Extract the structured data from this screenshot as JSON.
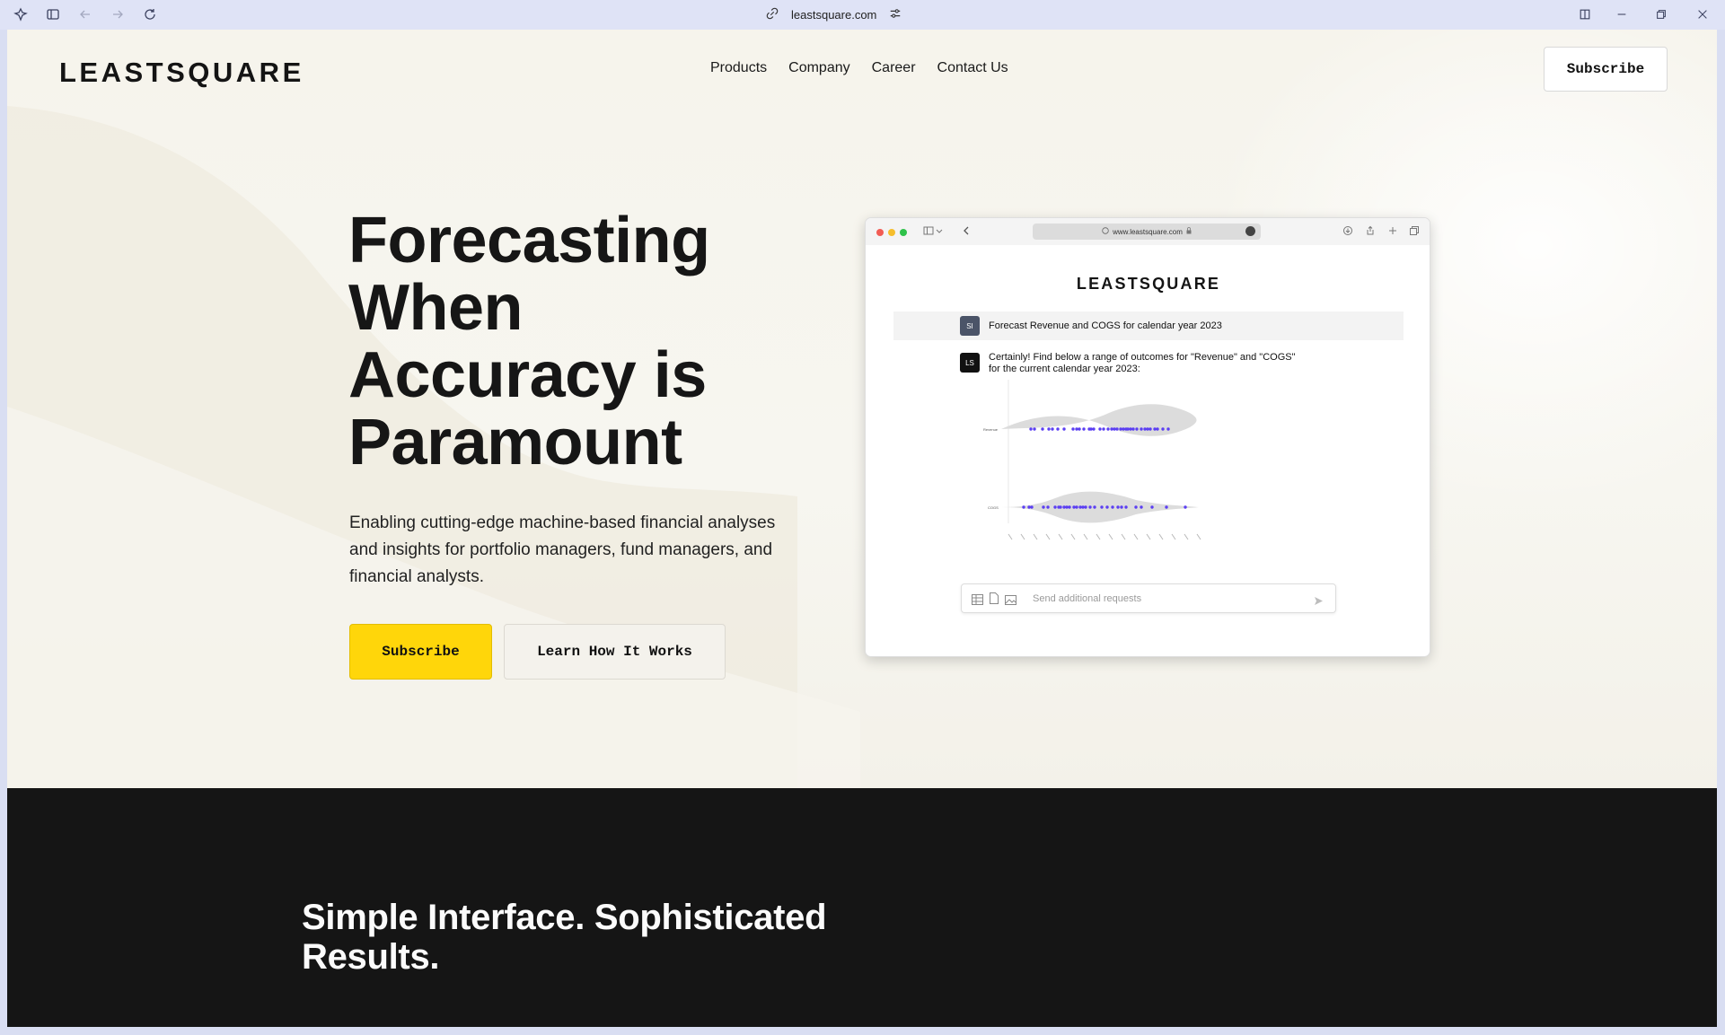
{
  "browser": {
    "url": "leastsquare.com",
    "icons": [
      "app-menu-icon",
      "sidebar-icon",
      "back-icon",
      "forward-icon",
      "reload-icon",
      "link-icon",
      "site-settings-icon",
      "split-view-icon",
      "minimize-icon",
      "restore-icon",
      "close-icon"
    ]
  },
  "site": {
    "logo": "LEASTSQUARE",
    "nav": [
      {
        "label": "Products"
      },
      {
        "label": "Company"
      },
      {
        "label": "Career"
      },
      {
        "label": "Contact Us"
      }
    ],
    "subscribe_top": "Subscribe"
  },
  "hero": {
    "headline_lines": [
      "Forecasting",
      "When",
      "Accuracy is",
      "Paramount"
    ],
    "description": "Enabling cutting-edge machine-based financial analyses and insights for portfolio managers, fund managers, and financial analysts.",
    "primary_button": "Subscribe",
    "secondary_button": "Learn How It Works",
    "accent_color": "#ffd60a"
  },
  "mockup": {
    "url": "www.leastsquare.com",
    "logo": "LEASTSQUARE",
    "user_avatar": "SI",
    "user_message": "Forecast Revenue and COGS for calendar year 2023",
    "assistant_avatar": "LS",
    "assistant_message_line1": "Certainly! Find below a range of outcomes for \"Revenue\" and \"COGS\"",
    "assistant_message_line2": "for the current calendar year 2023:",
    "chart_rows": [
      "Revenue",
      "COGS"
    ],
    "input_placeholder": "Send additional requests",
    "dot_color": "#5b3ff2"
  },
  "section2": {
    "heading_line1": "Simple Interface. Sophisticated",
    "heading_line2": "Results."
  }
}
